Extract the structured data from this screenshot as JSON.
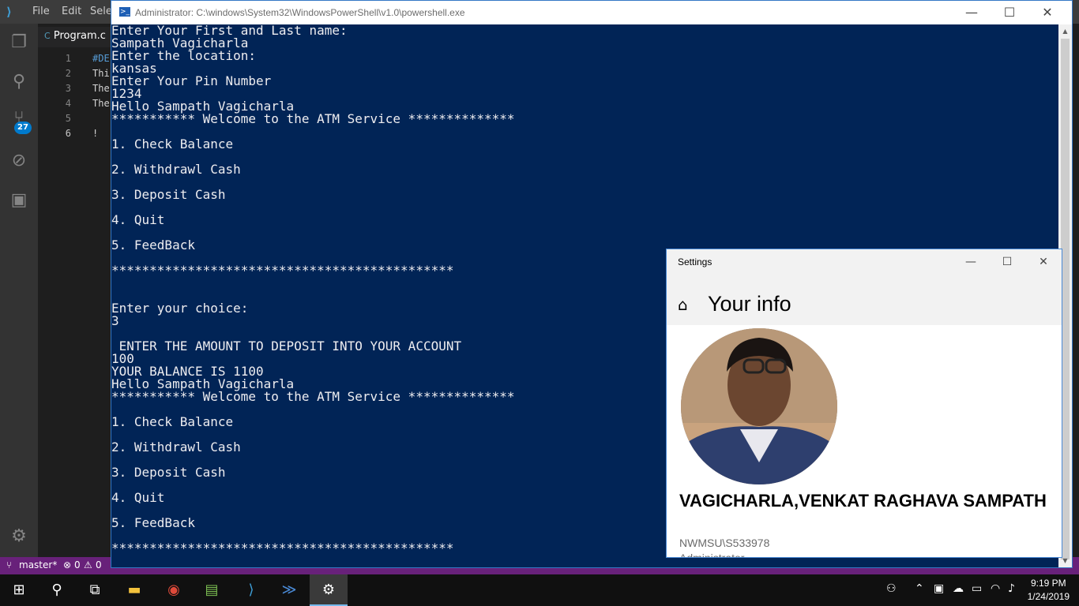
{
  "vscode": {
    "menu": [
      "File",
      "Edit",
      "Sele"
    ],
    "tab_label": "Program.c",
    "line_numbers": [
      "1",
      "2",
      "3",
      "4",
      "5",
      "6"
    ],
    "code_lines": [
      "#DE",
      "Thi",
      "The",
      "The",
      "",
      "!"
    ],
    "scm_badge": "27",
    "status_branch": "master*",
    "status_errors": "0",
    "status_warnings": "0"
  },
  "powershell": {
    "title": "Administrator: C:\\windows\\System32\\WindowsPowerShell\\v1.0\\powershell.exe",
    "lines": [
      "Enter Your First and Last name:",
      "Sampath Vagicharla",
      "Enter the location:",
      "kansas",
      "Enter Your Pin Number",
      "1234",
      "Hello Sampath Vagicharla",
      "*********** Welcome to the ATM Service **************",
      "",
      "1. Check Balance",
      "",
      "2. Withdrawl Cash",
      "",
      "3. Deposit Cash",
      "",
      "4. Quit",
      "",
      "5. FeedBack",
      "",
      "*********************************************",
      "",
      "",
      "Enter your choice:",
      "3",
      "",
      " ENTER THE AMOUNT TO DEPOSIT INTO YOUR ACCOUNT",
      "100",
      "YOUR BALANCE IS 1100",
      "Hello Sampath Vagicharla",
      "*********** Welcome to the ATM Service **************",
      "",
      "1. Check Balance",
      "",
      "2. Withdrawl Cash",
      "",
      "3. Deposit Cash",
      "",
      "4. Quit",
      "",
      "5. FeedBack",
      "",
      "*********************************************"
    ]
  },
  "settings": {
    "window_title": "Settings",
    "heading": "Your info",
    "user_name": "VAGICHARLA,VENKAT RAGHAVA SAMPATH",
    "account": "NWMSU\\S533978",
    "role": "Administrator"
  },
  "taskbar": {
    "time": "9:19 PM",
    "date": "1/24/2019"
  }
}
